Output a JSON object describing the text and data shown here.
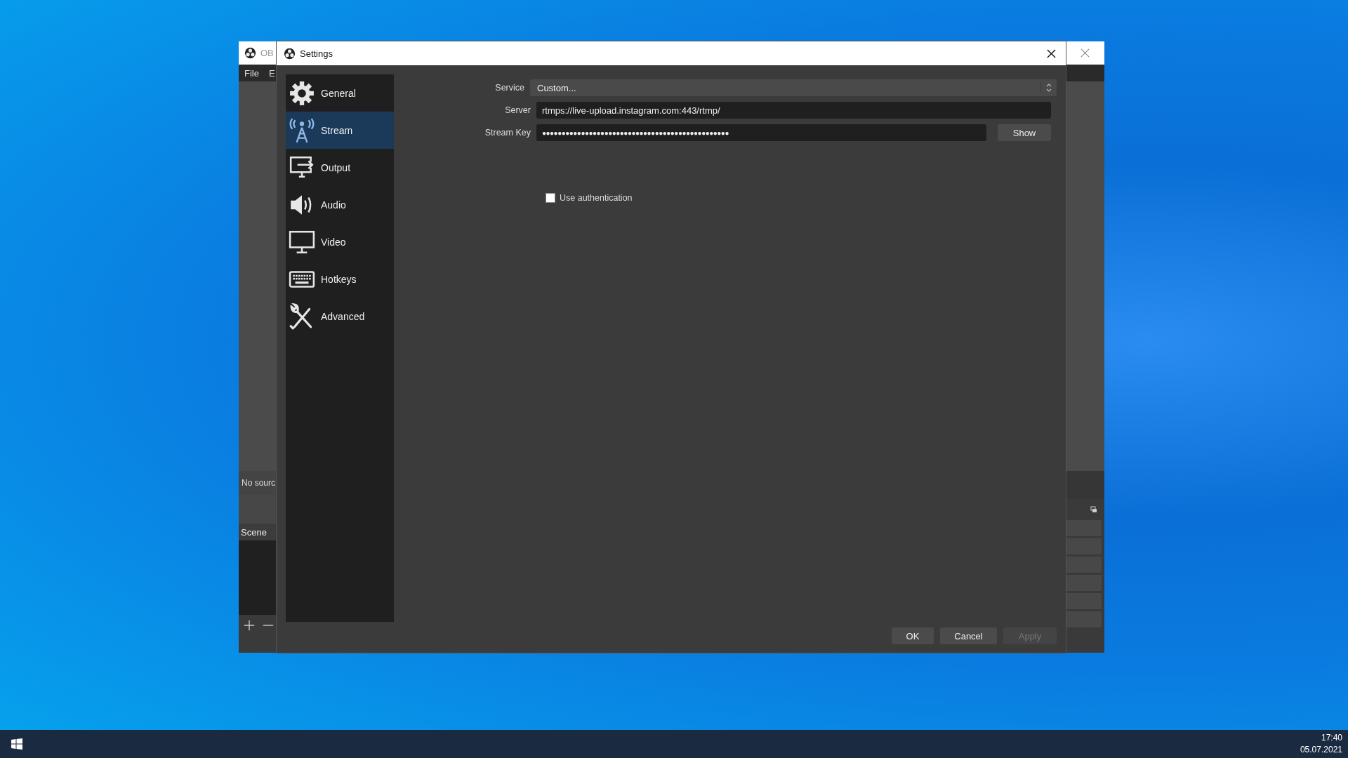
{
  "obs_window": {
    "title": "OB",
    "menu": [
      "File",
      "E"
    ],
    "preview_message": "No sourc",
    "scenes_header": "Scene"
  },
  "settings": {
    "title": "Settings",
    "sidebar": [
      {
        "label": "General",
        "kind": "gear",
        "selected": false
      },
      {
        "label": "Stream",
        "kind": "antenna",
        "selected": true
      },
      {
        "label": "Output",
        "kind": "output",
        "selected": false
      },
      {
        "label": "Audio",
        "kind": "speaker",
        "selected": false
      },
      {
        "label": "Video",
        "kind": "monitor",
        "selected": false
      },
      {
        "label": "Hotkeys",
        "kind": "keyboard",
        "selected": false
      },
      {
        "label": "Advanced",
        "kind": "tools",
        "selected": false
      }
    ],
    "service": {
      "label": "Service",
      "value": "Custom..."
    },
    "server": {
      "label": "Server",
      "value": "rtmps://live-upload.instagram.com:443/rtmp/"
    },
    "stream_key": {
      "label": "Stream Key",
      "value": "●●●●●●●●●●●●●●●●●●●●●●●●●●●●●●●●●●●●●●●●●●●●●●●●",
      "button": "Show"
    },
    "use_authentication": {
      "label": "Use authentication",
      "checked": false
    },
    "buttons": [
      {
        "label": "OK",
        "disabled": false
      },
      {
        "label": "Cancel",
        "disabled": false
      },
      {
        "label": "Apply",
        "disabled": true
      }
    ]
  },
  "taskbar": {
    "time": "17:40",
    "date": "05.07.2021"
  }
}
